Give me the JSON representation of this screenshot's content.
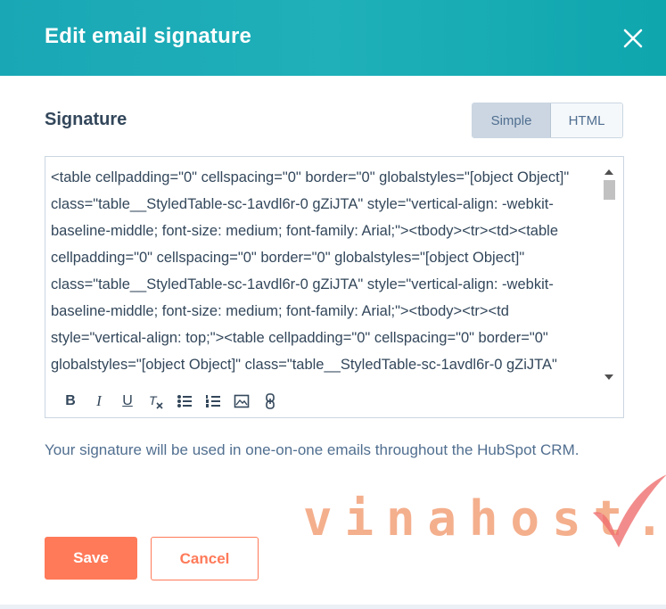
{
  "dialog": {
    "title": "Edit email signature",
    "close_icon": "close-icon"
  },
  "signature": {
    "section_title": "Signature",
    "toggle": {
      "simple_label": "Simple",
      "html_label": "HTML",
      "selected": "Simple"
    },
    "editor_content": "<table cellpadding=\"0\" cellspacing=\"0\" border=\"0\" globalstyles=\"[object Object]\" class=\"table__StyledTable-sc-1avdl6r-0 gZiJTA\" style=\"vertical-align: -webkit-baseline-middle; font-size: medium; font-family: Arial;\"><tbody><tr><td><table cellpadding=\"0\" cellspacing=\"0\" border=\"0\" globalstyles=\"[object Object]\" class=\"table__StyledTable-sc-1avdl6r-0 gZiJTA\" style=\"vertical-align: -webkit-baseline-middle; font-size: medium; font-family: Arial;\"><tbody><tr><td style=\"vertical-align: top;\"><table cellpadding=\"0\" cellspacing=\"0\" border=\"0\" globalstyles=\"[object Object]\" class=\"table__StyledTable-sc-1avdl6r-0 gZiJTA\" style=\"vertical-align: -webkit-baseline-middle; font-size: medium; font-family: Arial;\">",
    "toolbar": [
      {
        "name": "bold-icon",
        "glyph": "B"
      },
      {
        "name": "italic-icon",
        "glyph": "I"
      },
      {
        "name": "underline-icon",
        "glyph": "U"
      },
      {
        "name": "clear-format-icon",
        "glyph": "Tx"
      },
      {
        "name": "bulleted-list-icon",
        "glyph": ""
      },
      {
        "name": "numbered-list-icon",
        "glyph": ""
      },
      {
        "name": "image-icon",
        "glyph": ""
      },
      {
        "name": "link-icon",
        "glyph": ""
      }
    ]
  },
  "help_text": "Your signature will be used in one-on-one emails throughout the HubSpot CRM.",
  "watermark": {
    "text": "vinahost."
  },
  "actions": {
    "save_label": "Save",
    "cancel_label": "Cancel"
  },
  "colors": {
    "header": "#1aabb5",
    "accent": "#ff7a59",
    "text": "#33475b"
  }
}
